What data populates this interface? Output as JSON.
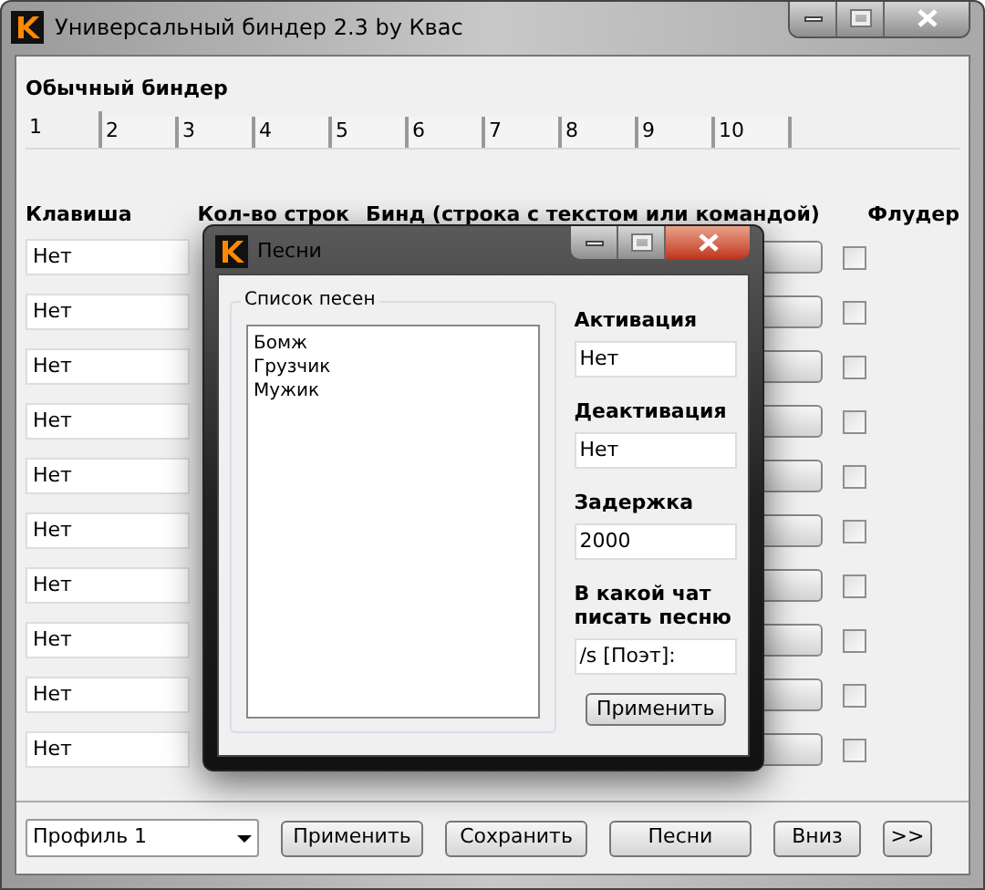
{
  "window": {
    "title": "Универсальный биндер 2.3 by Квас"
  },
  "section_title": "Обычный биндер",
  "tabs": [
    {
      "label": "1",
      "selected": true
    },
    {
      "label": "2",
      "selected": false
    },
    {
      "label": "3",
      "selected": false
    },
    {
      "label": "4",
      "selected": false
    },
    {
      "label": "5",
      "selected": false
    },
    {
      "label": "6",
      "selected": false
    },
    {
      "label": "7",
      "selected": false
    },
    {
      "label": "8",
      "selected": false
    },
    {
      "label": "9",
      "selected": false
    },
    {
      "label": "10",
      "selected": false
    }
  ],
  "columns": [
    "Клавиша",
    "Кол-во строк",
    "Бинд (строка с текстом или командой)",
    "Флудер"
  ],
  "rows": [
    {
      "key": "Нет",
      "flooder": false
    },
    {
      "key": "Нет",
      "flooder": false
    },
    {
      "key": "Нет",
      "flooder": false
    },
    {
      "key": "Нет",
      "flooder": false
    },
    {
      "key": "Нет",
      "flooder": false
    },
    {
      "key": "Нет",
      "flooder": false
    },
    {
      "key": "Нет",
      "flooder": false
    },
    {
      "key": "Нет",
      "flooder": false
    },
    {
      "key": "Нет",
      "flooder": false
    },
    {
      "key": "Нет",
      "flooder": false
    }
  ],
  "bottom_bar": {
    "profile": "Профиль 1",
    "buttons": [
      "Применить",
      "Сохранить",
      "Песни",
      "Вниз",
      ">>"
    ]
  },
  "dialog": {
    "title": "Песни",
    "group_title": "Список песен",
    "songs": [
      "Бомж",
      "Грузчик",
      "Мужик"
    ],
    "fields": [
      {
        "label": "Активация",
        "value": "Нет"
      },
      {
        "label": "Деактивация",
        "value": "Нет"
      },
      {
        "label": "Задержка",
        "value": "2000"
      },
      {
        "label": "В какой чат писать песню",
        "value": "/s [Поэт]:"
      }
    ],
    "apply_button": "Применить"
  }
}
